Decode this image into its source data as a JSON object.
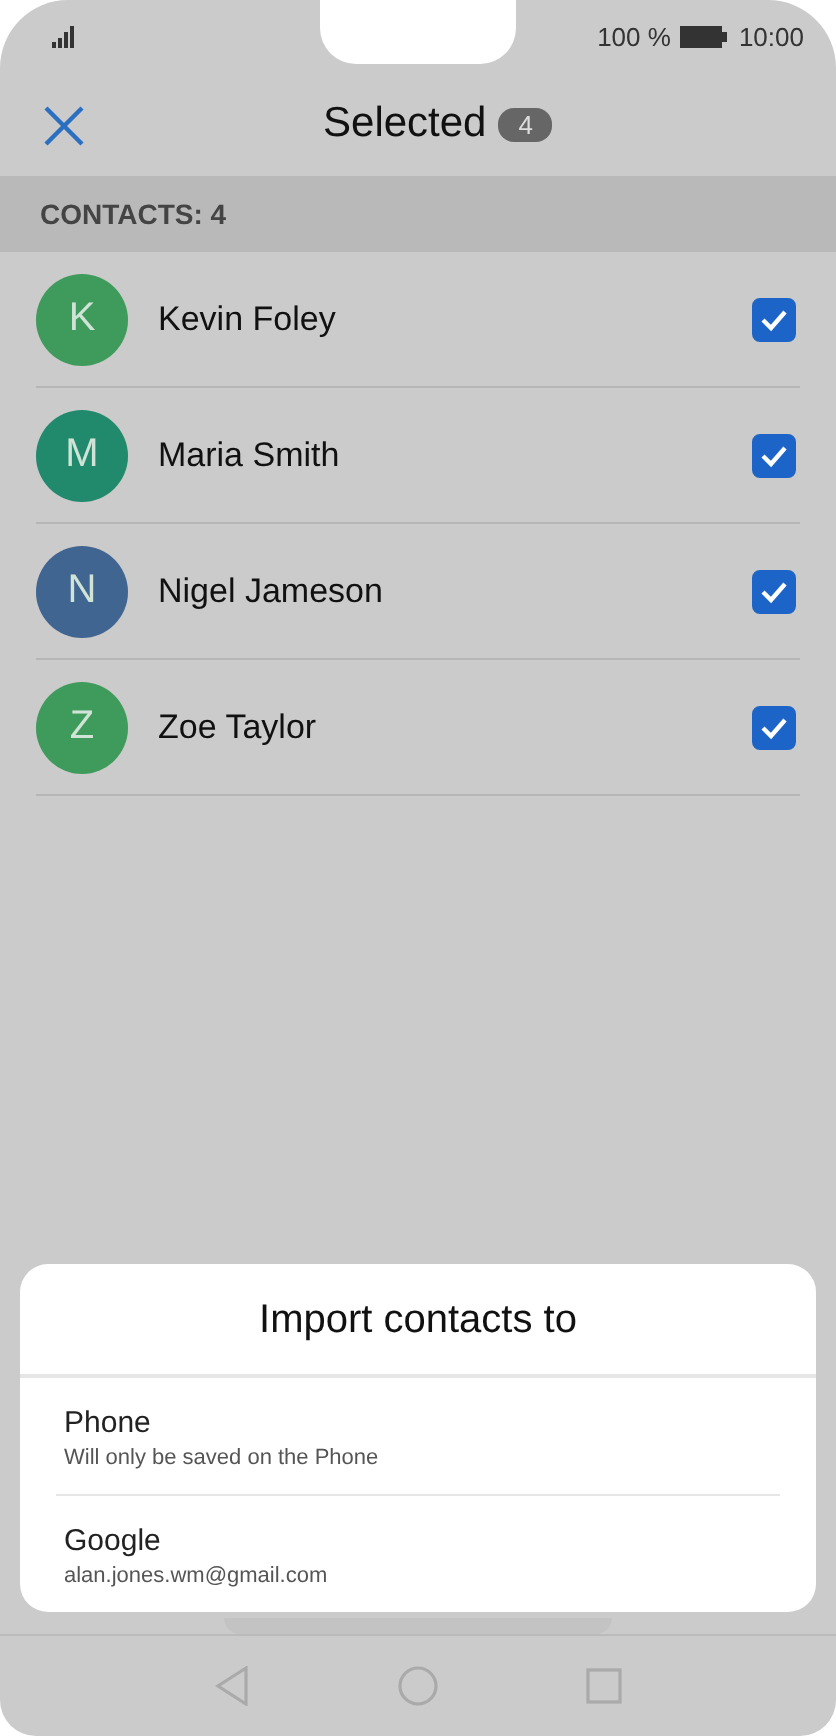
{
  "status_bar": {
    "battery": "100 %",
    "time": "10:00"
  },
  "header": {
    "title": "Selected",
    "count": "4"
  },
  "section": {
    "label": "CONTACTS: 4"
  },
  "contacts": [
    {
      "initial": "K",
      "name": "Kevin Foley",
      "color": "#3f9b5b",
      "checked": true
    },
    {
      "initial": "M",
      "name": "Maria Smith",
      "color": "#21896c",
      "checked": true
    },
    {
      "initial": "N",
      "name": "Nigel Jameson",
      "color": "#3f6590",
      "checked": true
    },
    {
      "initial": "Z",
      "name": "Zoe Taylor",
      "color": "#3f9b5b",
      "checked": true
    }
  ],
  "dialog": {
    "title": "Import contacts to",
    "options": [
      {
        "label": "Phone",
        "detail": "Will only be saved on the Phone"
      },
      {
        "label": "Google",
        "detail": "alan.jones.wm@gmail.com"
      }
    ]
  }
}
